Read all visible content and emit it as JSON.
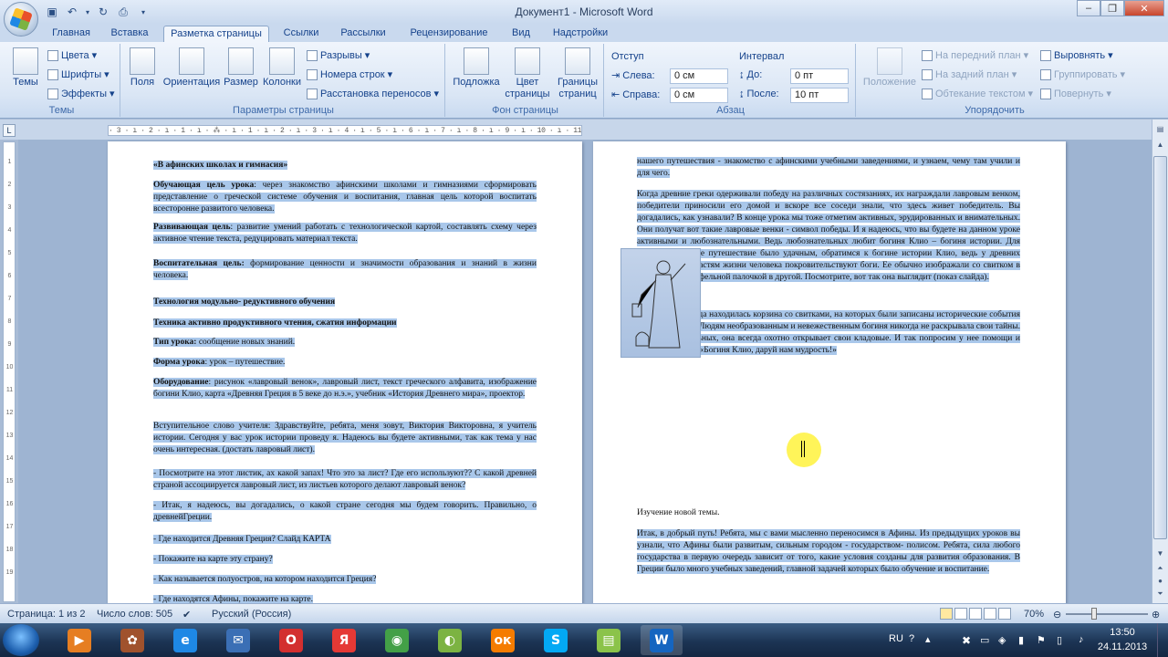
{
  "window": {
    "title": "Документ1 - Microsoft Word"
  },
  "tabs": [
    "Главная",
    "Вставка",
    "Разметка страницы",
    "Ссылки",
    "Рассылки",
    "Рецензирование",
    "Вид",
    "Надстройки"
  ],
  "ribbon": {
    "themes": {
      "group": "Темы",
      "big": "Темы",
      "colors": "Цвета",
      "fonts": "Шрифты",
      "effects": "Эффекты"
    },
    "page_setup": {
      "group": "Параметры страницы",
      "margins": "Поля",
      "orientation": "Ориентация",
      "size": "Размер",
      "columns": "Колонки",
      "breaks": "Разрывы",
      "line_numbers": "Номера строк",
      "hyphenation": "Расстановка переносов"
    },
    "background": {
      "group": "Фон страницы",
      "watermark": "Подложка",
      "page_color_1": "Цвет",
      "page_color_2": "страницы",
      "borders_1": "Границы",
      "borders_2": "страниц"
    },
    "paragraph": {
      "group": "Абзац",
      "indent": "Отступ",
      "left_label": "Слева:",
      "left_val": "0 см",
      "right_label": "Справа:",
      "right_val": "0 см",
      "spacing": "Интервал",
      "before_label": "До:",
      "before_val": "0 пт",
      "after_label": "После:",
      "after_val": "10 пт"
    },
    "arrange": {
      "group": "Упорядочить",
      "position": "Положение",
      "front": "На передний план",
      "back": "На задний план",
      "wrap": "Обтекание текстом",
      "align": "Выровнять",
      "group_btn": "Группировать",
      "rotate": "Повернуть"
    }
  },
  "ruler": {
    "top_left": "· 3 · ı · 2 · ı · 1 · ı · ⁂ · ı · 1 · ı · 2 · ı · 3 · ı · 4 · ı · 5 · ı · 6 · ı · 7 · ı · 8 · ı · 9 · ı · 10 · ı · 11 · ı · 12 · ı · 13 · ı · 14 · ı · 15 · ı · 16 · ı · 17 · ı · 18 · ı · 19 · ı · 20 · ı · 21 · ı · 22 · ı · 23 · ı · 24 · ı · 25 · ı · 26 · ı · 27 · ı · 28 · ı · 29 · ı · 30 · ı · 31 · ı · 32 · ı · 33 · ı · 34 · ı · 35 · ı · 36 · ı · 37 · ı · 38 ·",
    "vticks": [
      "1",
      "2",
      "3",
      "4",
      "5",
      "6",
      "7",
      "8",
      "9",
      "10",
      "11",
      "12",
      "13",
      "14",
      "15",
      "16",
      "17",
      "18",
      "19"
    ]
  },
  "page1": [
    {
      "label": "«В афинских школах и гимнасия»",
      "text": ""
    },
    {
      "label": "Обучающая цель урока",
      "text": ": через знакомство афинскими школами и гимназиями сформировать представление о греческой системе обучения и воспитания, главная цель которой воспитать всесторонне развитого человека."
    },
    {
      "label": "Развивающая цель",
      "text": ": развитие умений работать с технологической картой, составлять схему через активное чтение текста, редуцировать материал текста."
    },
    {
      "label": "Воспитательная цель:",
      "text": " формирование ценности и значимости образования и знаний в жизни человека."
    },
    {
      "label": "Технология модульно- редуктивного обучения",
      "text": ""
    },
    {
      "label": "Техника активно продуктивного чтения, сжатия информации",
      "text": ""
    },
    {
      "label": "Тип урока:",
      "text": " сообщение новых знаний."
    },
    {
      "label": "Форма урока",
      "text": ": урок – путешествие."
    },
    {
      "label": "Оборудование",
      "text": ": рисунок «лавровый венок», лавровый лист, текст греческого алфавита, изображение богини Клио, карта «Древняя Греция в 5 веке до н.э.», учебник «История Древнего мира», проектор."
    },
    {
      "label": "",
      "text": "Вступительное слово учителя: Здравствуйте, ребята, меня зовут, Виктория Викторовна, я учитель истории. Сегодня у вас урок истории проведу я. Надеюсь вы будете активными, так как тема у нас очень интересная. (достать лавровый лист)."
    },
    {
      "label": "",
      "text": "- Посмотрите на этот листик, ах какой запах! Что это за лист? Где его используют?? С какой древней страной ассоциируется лавровый лист, из листьев которого делают лавровый венок?"
    },
    {
      "label": "",
      "text": "- Итак, я надеюсь, вы догадались, о какой стране сегодня мы будем говорить. Правильно, о древнейГреции."
    },
    {
      "label": "",
      "text": "- Где находится Древняя Греция? Слайд КАРТА"
    },
    {
      "label": "",
      "text": "- Покажите на карте эту страну?"
    },
    {
      "label": "",
      "text": "- Как называется полуостров, на котором находится Греция?"
    },
    {
      "label": "",
      "text": "- Где находятся Афины, покажите на карте."
    }
  ],
  "page2": [
    "нашего путешествия - знакомство с афинскими учебными заведениями, и узнаем, чему там учили и для чего.",
    "Когда древние греки одерживали победу на различных состязаниях, их награждали лавровым венком, победители приносили его домой и вскоре все соседи знали, что здесь живет победитель. Вы догадались, как узнавали? В конце урока мы тоже отметим активных, эрудированных и внимательных. Они получат вот такие лавровые венки - символ победы. И я надеюсь, что вы будете на данном уроке активными и любознательными. Ведь любознательных любит богиня Клио – богиня истории. Для того, чтобы наше путешествие было удачным, обратимся к богине истории Клио, ведь у древних греков, всем областям жизни человека покровительствуют боги. Ее обычно изображали со свитком в одной руке и грифельной палочкой в другой. Посмотрите, вот так она выглядит (показ слайда).",
    "Рядом с ней всегда находилась корзина со свитками, на которых были записаны исторические события и деяния людей. Людям необразованным и невежественным богиня никогда не раскрывала свои тайны. Для любознательных, она всегда охотно открывает свои кладовые. И так попросим у нее помощи и благословления. «Богиня Клио, даруй нам мудрость!»",
    "Изучение новой темы.",
    "Итак, в добрый путь! Ребята, мы с вами мысленно переносимся в Афины. Из предыдущих уроков вы узнали, что Афины были развитым, сильным городом - государством- полисом. Ребята, сила любого государства в первую очередь зависит от того, какие условия созданы для развития образования. В Греции было много учебных заведений, главной задачей которых было обучение и воспитание."
  ],
  "status": {
    "page": "Страница: 1 из 2",
    "words": "Число слов: 505",
    "lang": "Русский (Россия)",
    "zoom": "70%"
  },
  "tray": {
    "lang": "RU",
    "time": "13:50",
    "date": "24.11.2013"
  },
  "taskbar": [
    {
      "name": "media-player-icon",
      "glyph": "▶",
      "color": "#e67e22"
    },
    {
      "name": "paint-icon",
      "glyph": "✿",
      "color": "#a0522d"
    },
    {
      "name": "internet-explorer-icon",
      "glyph": "e",
      "color": "#1e88e5"
    },
    {
      "name": "mail-icon",
      "glyph": "✉",
      "color": "#3b6fb5"
    },
    {
      "name": "opera-icon",
      "glyph": "O",
      "color": "#d32f2f"
    },
    {
      "name": "yandex-icon",
      "glyph": "Я",
      "color": "#e53935"
    },
    {
      "name": "chrome-icon",
      "glyph": "◉",
      "color": "#43a047"
    },
    {
      "name": "agent-icon",
      "glyph": "◐",
      "color": "#7cb342"
    },
    {
      "name": "odnoklassniki-icon",
      "glyph": "ок",
      "color": "#f57c00"
    },
    {
      "name": "skype-icon",
      "glyph": "S",
      "color": "#03a9f4"
    },
    {
      "name": "archive-icon",
      "glyph": "▤",
      "color": "#8bc34a"
    },
    {
      "name": "word-icon",
      "glyph": "W",
      "color": "#1565c0"
    }
  ]
}
